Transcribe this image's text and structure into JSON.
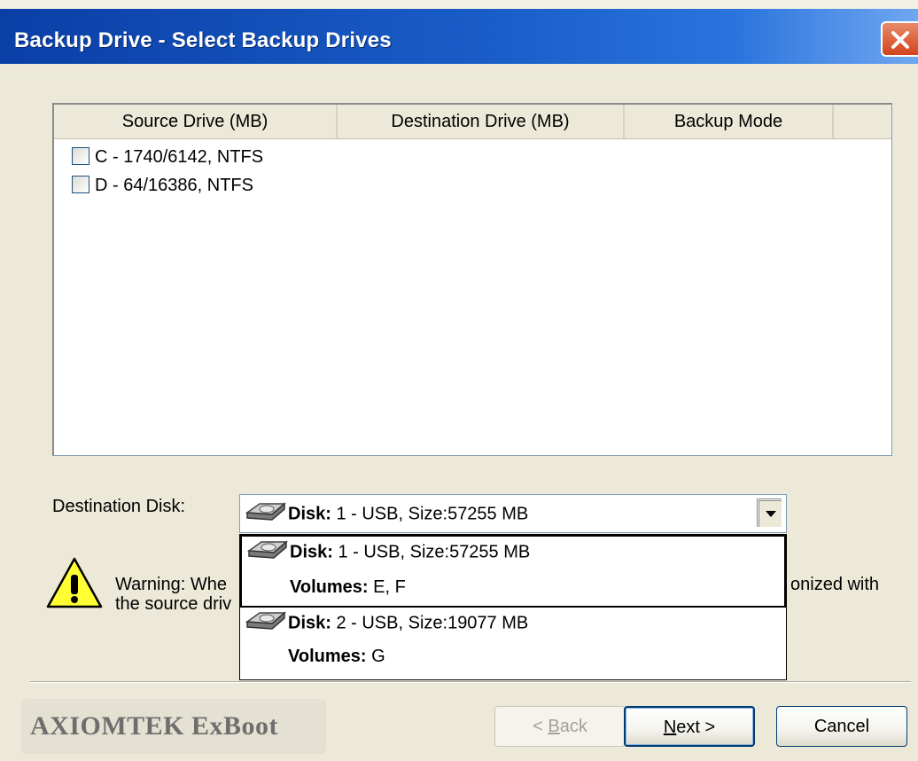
{
  "window": {
    "title": "Backup Drive - Select Backup Drives"
  },
  "list": {
    "columns": [
      "Source Drive (MB)",
      "Destination Drive (MB)",
      "Backup Mode"
    ],
    "rows": [
      {
        "label": "C - 1740/6142, NTFS",
        "checked": false
      },
      {
        "label": "D - 64/16386, NTFS",
        "checked": false
      }
    ]
  },
  "destination": {
    "label": "Destination Disk:",
    "selected": {
      "disk_key": "Disk:",
      "disk_value": "1 - USB, Size:57255 MB"
    },
    "options": [
      {
        "disk_key": "Disk:",
        "disk_value": "1 - USB, Size:57255 MB",
        "vol_key": "Volumes:",
        "vol_value": "E, F"
      },
      {
        "disk_key": "Disk:",
        "disk_value": "2 - USB, Size:19077 MB",
        "vol_key": "Volumes:",
        "vol_value": "G"
      }
    ]
  },
  "warning": {
    "line1": "Warning: Whe",
    "line2": "the source driv",
    "right": "onized with"
  },
  "footer": {
    "brand": "AXIOMTEK ExBoot",
    "back_prefix": "< ",
    "back_u": "B",
    "back_rest": "ack",
    "next_u": "N",
    "next_rest": "ext >",
    "cancel": "Cancel"
  },
  "icons": [
    "close-icon",
    "disk-icon",
    "warning-icon",
    "chevron-down-icon"
  ],
  "colors": {
    "titlebar": "#0a3fa6",
    "dialog_bg": "#ece9d8",
    "close": "#d2441d"
  }
}
